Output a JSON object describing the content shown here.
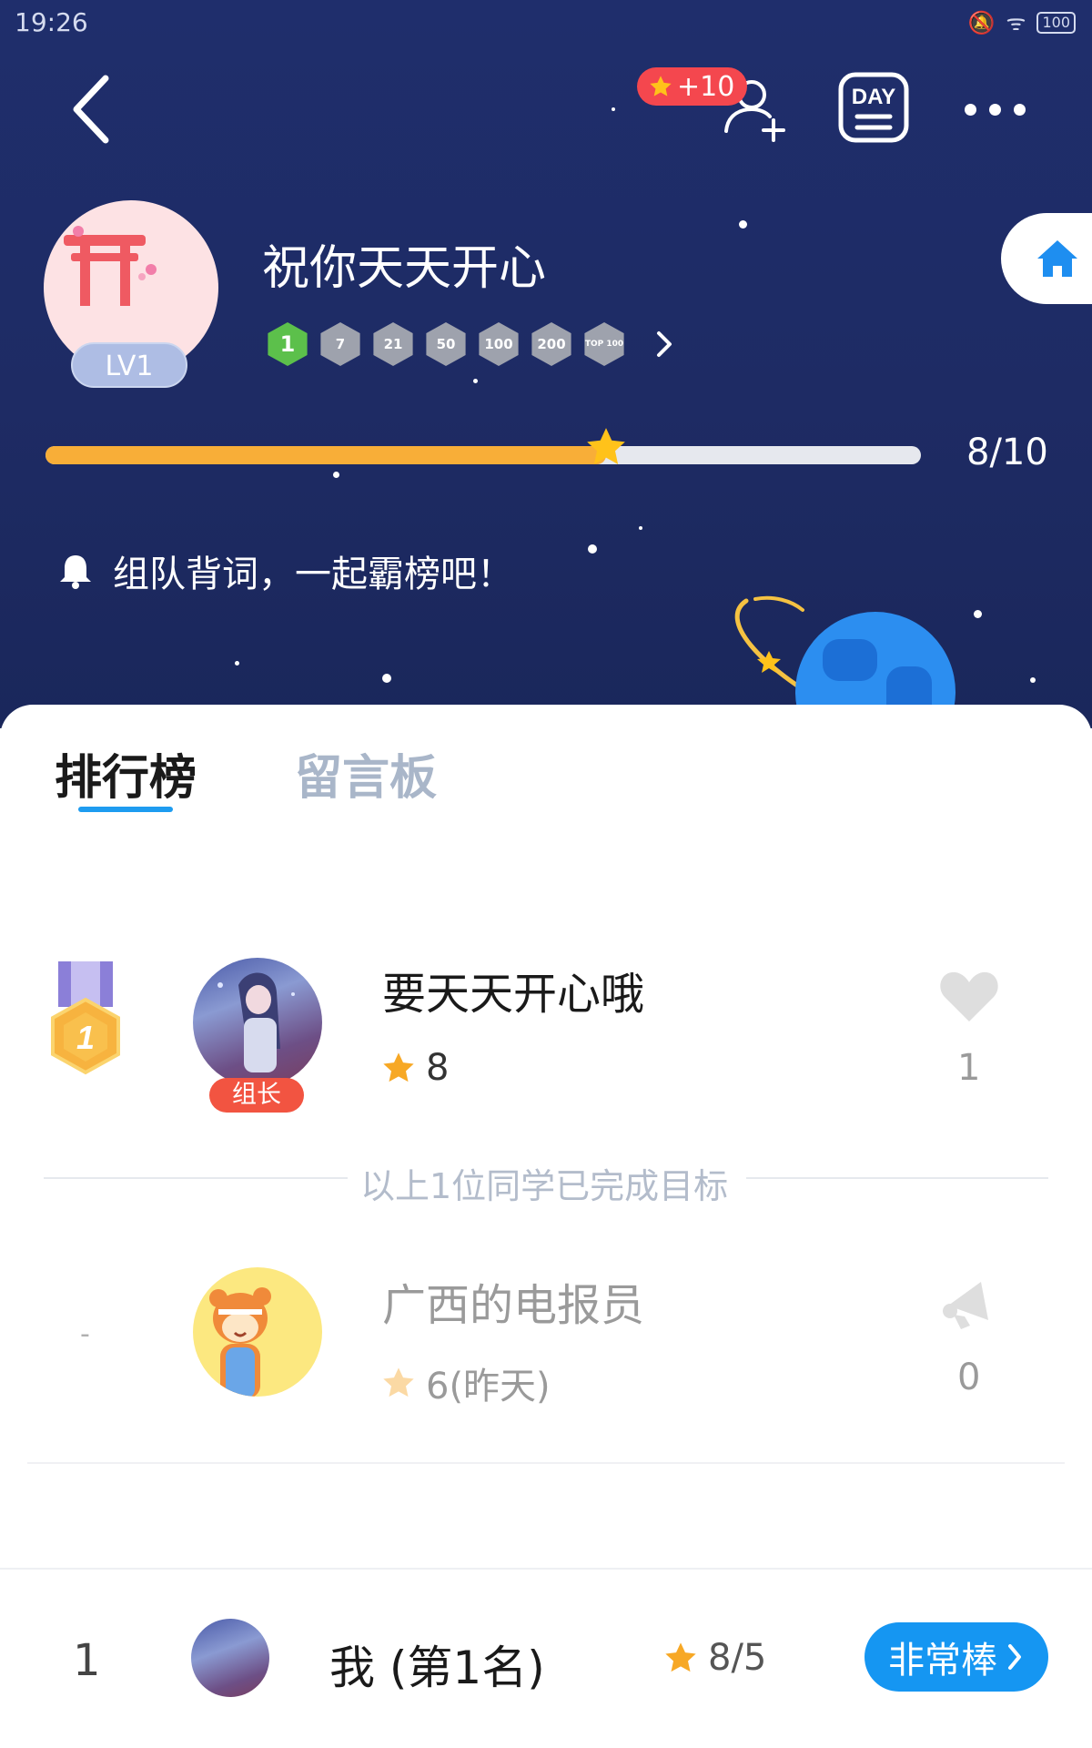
{
  "status_bar": {
    "time": "19:26",
    "battery": "100"
  },
  "header": {
    "reward_badge": "+10",
    "day_label": "DAY",
    "group_name": "祝你天天开心",
    "level": "LV1",
    "medals": [
      "1",
      "7",
      "21",
      "50",
      "100",
      "200",
      "TOP 100"
    ],
    "progress": {
      "text": "8/10",
      "current": 8,
      "target": 10
    },
    "announcement": "组队背词，一起霸榜吧！"
  },
  "tabs": {
    "ranking": "排行榜",
    "board": "留言板"
  },
  "members": [
    {
      "rank_icon": "gold-medal-icon",
      "rank_number": "1",
      "name": "要天天开心哦",
      "badge": "组长",
      "stars": "8",
      "likes": "1"
    },
    {
      "rank_icon": "dash",
      "rank_text": "-",
      "name": "广西的电报员",
      "stars": "6(昨天)",
      "likes": "0"
    }
  ],
  "divider_text": "以上1位同学已完成目标",
  "bottom": {
    "rank": "1",
    "name": "我 (第1名)",
    "stars": "8/5",
    "button_label": "非常棒"
  },
  "colors": {
    "header_bg": "#1e2b64",
    "accent": "#1e9cf0",
    "progress": "#f8ae38",
    "badge_red": "#f25441",
    "button_blue": "#1596f2"
  }
}
